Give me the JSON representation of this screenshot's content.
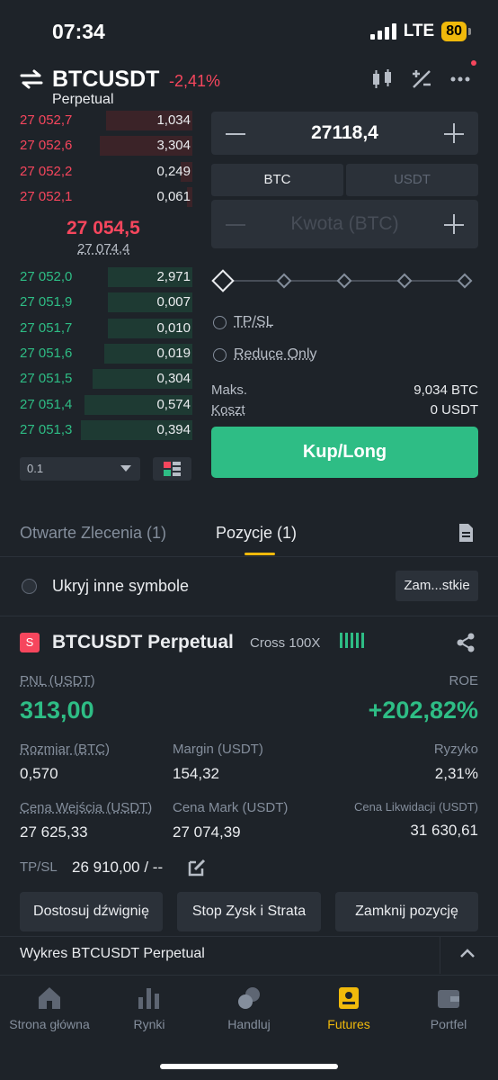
{
  "status": {
    "time": "07:34",
    "network": "LTE",
    "battery": "80"
  },
  "header": {
    "pair": "BTCUSDT",
    "change": "-2,41%",
    "contract": "Perpetual"
  },
  "orderbook": {
    "asks": [
      {
        "price": "27 052,7",
        "qty": "1,034",
        "depth": 0.45
      },
      {
        "price": "27 052,6",
        "qty": "3,304",
        "depth": 0.48
      },
      {
        "price": "27 052,2",
        "qty": "0,249",
        "depth": 0.06
      },
      {
        "price": "27 052,1",
        "qty": "0,061",
        "depth": 0.03
      }
    ],
    "last_price": "27 054,5",
    "mark_price": "27 074,4",
    "bids": [
      {
        "price": "27 052,0",
        "qty": "2,971",
        "depth": 0.44
      },
      {
        "price": "27 051,9",
        "qty": "0,007",
        "depth": 0.44
      },
      {
        "price": "27 051,7",
        "qty": "0,010",
        "depth": 0.44
      },
      {
        "price": "27 051,6",
        "qty": "0,019",
        "depth": 0.46
      },
      {
        "price": "27 051,5",
        "qty": "0,304",
        "depth": 0.52
      },
      {
        "price": "27 051,4",
        "qty": "0,574",
        "depth": 0.56
      },
      {
        "price": "27 051,3",
        "qty": "0,394",
        "depth": 0.58
      }
    ],
    "depth_step": "0.1"
  },
  "order_form": {
    "price": "27118,4",
    "unit_btc": "BTC",
    "unit_usdt": "USDT",
    "amount_placeholder": "Kwota (BTC)",
    "tpsl": "TP/SL",
    "reduce_only": "Reduce Only",
    "max_label": "Maks.",
    "max_value": "9,034 BTC",
    "cost_label": "Koszt",
    "cost_value": "0 USDT",
    "buy_label": "Kup/Long"
  },
  "tabs": {
    "open_orders": "Otwarte Zlecenia (1)",
    "positions": "Pozycje (1)"
  },
  "filter": {
    "hide_label": "Ukryj inne symbole",
    "close_all": "Zam...stkie"
  },
  "position": {
    "side": "S",
    "symbol": "BTCUSDT Perpetual",
    "margin_mode": "Cross 100X",
    "pnl_label": "PNL (USDT)",
    "pnl_value": "313,00",
    "roe_label": "ROE",
    "roe_value": "+202,82%",
    "size_label": "Rozmiar (BTC)",
    "size_value": "0,570",
    "margin_label": "Margin (USDT)",
    "margin_value": "154,32",
    "risk_label": "Ryzyko",
    "risk_value": "2,31%",
    "entry_label": "Cena Wejścia (USDT)",
    "entry_value": "27 625,33",
    "mark_label": "Cena Mark (USDT)",
    "mark_value": "27 074,39",
    "liq_label": "Cena Likwidacji (USDT)",
    "liq_value": "31 630,61",
    "tpsl_label": "TP/SL",
    "tpsl_value": "26 910,00 / --",
    "btn_leverage": "Dostosuj dźwignię",
    "btn_stop": "Stop Zysk i Strata",
    "btn_close": "Zamknij pozycję"
  },
  "chart_link": "Wykres BTCUSDT Perpetual",
  "nav": {
    "home": "Strona główna",
    "markets": "Rynki",
    "trade": "Handluj",
    "futures": "Futures",
    "wallet": "Portfel"
  },
  "colors": {
    "red": "#f6465d",
    "green": "#2ebd85",
    "accent": "#f0b90b",
    "bg": "#1e2329",
    "panel": "#2b3139"
  }
}
